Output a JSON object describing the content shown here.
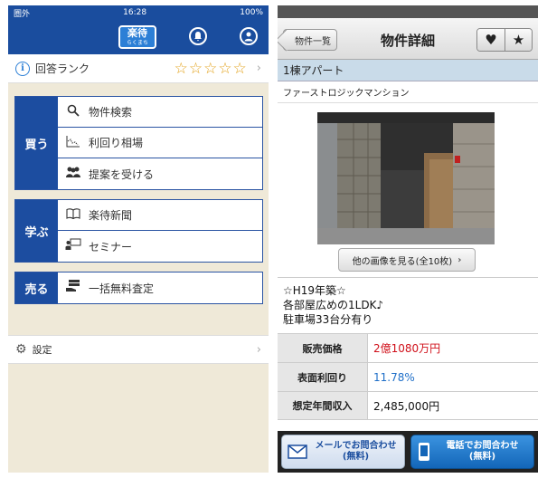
{
  "left": {
    "status": {
      "carrier": "圏外",
      "time": "16:28",
      "battery": "100%"
    },
    "logo": {
      "main": "楽待",
      "sub": "らくまち"
    },
    "rank": {
      "label": "回答ランク",
      "stars": "☆☆☆☆☆"
    },
    "groups": [
      {
        "category": "買う",
        "items": [
          "物件検索",
          "利回り相場",
          "提案を受ける"
        ]
      },
      {
        "category": "学ぶ",
        "items": [
          "楽待新聞",
          "セミナー"
        ]
      },
      {
        "category": "売る",
        "items": [
          "一括無料査定"
        ]
      }
    ],
    "settings": {
      "label": "設定"
    }
  },
  "right": {
    "nav": {
      "back": "物件一覧",
      "title": "物件詳細"
    },
    "type": "1棟アパート",
    "name": "ファーストロジックマンション",
    "more_images": "他の画像を見る(全10枚)",
    "description": [
      "☆H19年築☆",
      "各部屋広めの1LDK♪",
      "駐車場33台分有り"
    ],
    "specs": [
      {
        "label": "販売価格",
        "value": "2億1080万円",
        "color": "#d0101a"
      },
      {
        "label": "表面利回り",
        "value": "11.78%",
        "color": "#1f6fc8"
      },
      {
        "label": "想定年間収入",
        "value": "2,485,000円",
        "color": "#111111"
      }
    ],
    "cta": {
      "mail_line1": "メールでお問合わせ",
      "mail_line2": "(無料)",
      "tel_line1": "電話でお問合わせ",
      "tel_line2": "(無料)"
    }
  },
  "colors": {
    "brand_blue": "#1a4d9e",
    "price_red": "#d0101a",
    "yield_blue": "#1f6fc8"
  }
}
